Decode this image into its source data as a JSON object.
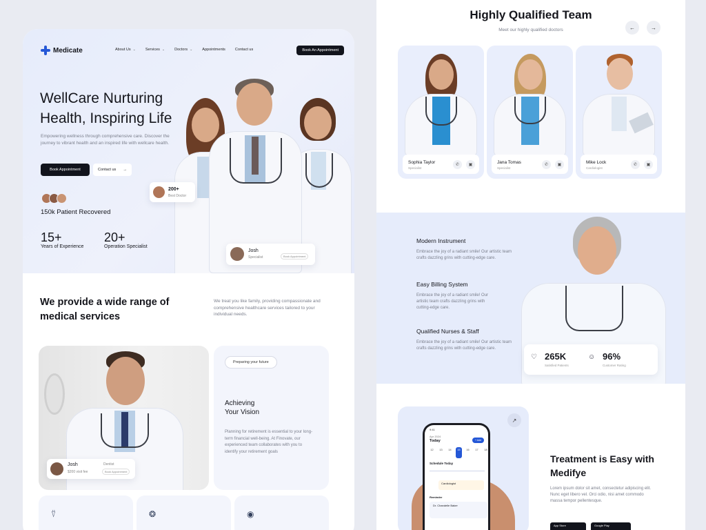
{
  "nav": {
    "brand": "Medicate",
    "links": [
      "About Us",
      "Services",
      "Doctors",
      "Appointments",
      "Contact us"
    ],
    "cta": "Book An Appointment"
  },
  "hero": {
    "title": "WellCare Nurturing Health, Inspiring Life",
    "description": "Empowering wellness through comprehensive care. Discover the journey to vibrant health and an inspired life with wellcare health.",
    "primary_button": "Book Appointment",
    "secondary_button": "Contact us",
    "recovered": "150k Patient Recovered",
    "stat1_value": "15+",
    "stat1_label": "Years of Experience",
    "stat2_value": "20+",
    "stat2_label": "Operation Specialist",
    "badge_value": "200+",
    "badge_label": "Best Doctor",
    "doctor_name": "Josh",
    "doctor_role": "Specialist",
    "doctor_action": "Book Appointment"
  },
  "services": {
    "heading": "We provide a wide range of medical services",
    "description": "We treat you like family, providing compassionate and comprehensive healthcare services tailored to your individual needs.",
    "card_name": "Josh",
    "card_role": "Dentist",
    "card_price": "$200 visit fee",
    "card_action": "Book Appointment",
    "pill": "Preparing your future",
    "vision_title": "Achieving Your Vision",
    "vision_desc": "Planning for retirement is essential to your long-term financial well-being. At Finovate, our experienced team collaborates with you to identify your retirement goals"
  },
  "team": {
    "title": "Highly Qualified Team",
    "subtitle": "Meet our highly qualified doctors",
    "members": [
      {
        "name": "Sophia Taylor",
        "role": "Specialist"
      },
      {
        "name": "Jana Tomas",
        "role": "Specialist"
      },
      {
        "name": "Mike Lock",
        "role": "Cardiologist"
      }
    ]
  },
  "features": {
    "items": [
      {
        "title": "Modern Instrument",
        "desc": "Embrace the joy of a radiant smile! Our artistic team crafts dazzling grins with cutting-edge care."
      },
      {
        "title": "Easy Billing System",
        "desc": "Embrace the joy of a radiant smile! Our artistic team crafts dazzling grins with cutting-edge care."
      },
      {
        "title": "Qualified Nurses & Staff",
        "desc": "Embrace the joy of a radiant smile! Our artistic team crafts dazzling grins with cutting-edge care."
      }
    ],
    "stat1_value": "265K",
    "stat1_label": "Satisfied Patients",
    "stat2_value": "96%",
    "stat2_label": "Customer Rating"
  },
  "app": {
    "title": "Treatment is Easy with Medifye",
    "description": "Lorem ipsum dolor sit amet, consectetur adipiscing elit. Nunc eget libero vel. Orci odio, nisi amet commodo massa tempor pellentesque.",
    "phone_time": "9:41",
    "phone_date": "Apr 2024",
    "phone_today": "Today",
    "phone_add": "+ Add",
    "days": [
      "12",
      "13",
      "14",
      "15",
      "16",
      "17",
      "18"
    ],
    "schedule_label": "Schedule Today",
    "event": "Cardiologist",
    "reminder": "Reminder",
    "reminder_doctor": "Dr. Chandelle Baker",
    "store1": "App Store",
    "store2": "Google Play"
  }
}
